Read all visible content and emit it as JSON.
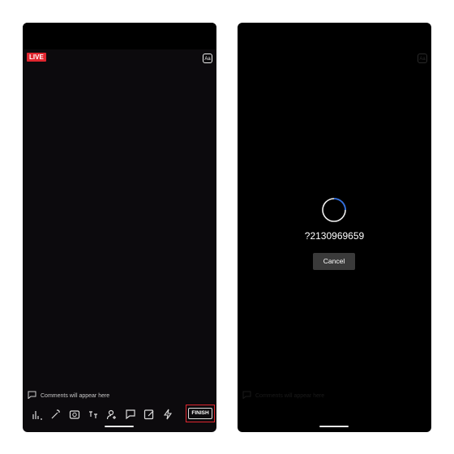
{
  "left_screen": {
    "live_badge": "LIVE",
    "aa_button": "Aa",
    "comments_placeholder": "Comments will appear here",
    "toolbar_icons": [
      "poll-icon",
      "magic-wand-icon",
      "flip-camera-icon",
      "captions-icon",
      "add-guest-icon",
      "comment-icon",
      "edit-icon",
      "flash-icon"
    ],
    "finish_label": "FINISH"
  },
  "right_screen": {
    "aa_button": "Aa",
    "number": "?2130969659",
    "cancel_label": "Cancel",
    "comments_placeholder": "Comments will appear here"
  },
  "colors": {
    "live_red": "#e0262f",
    "spinner_blue": "#2d6cdf"
  }
}
